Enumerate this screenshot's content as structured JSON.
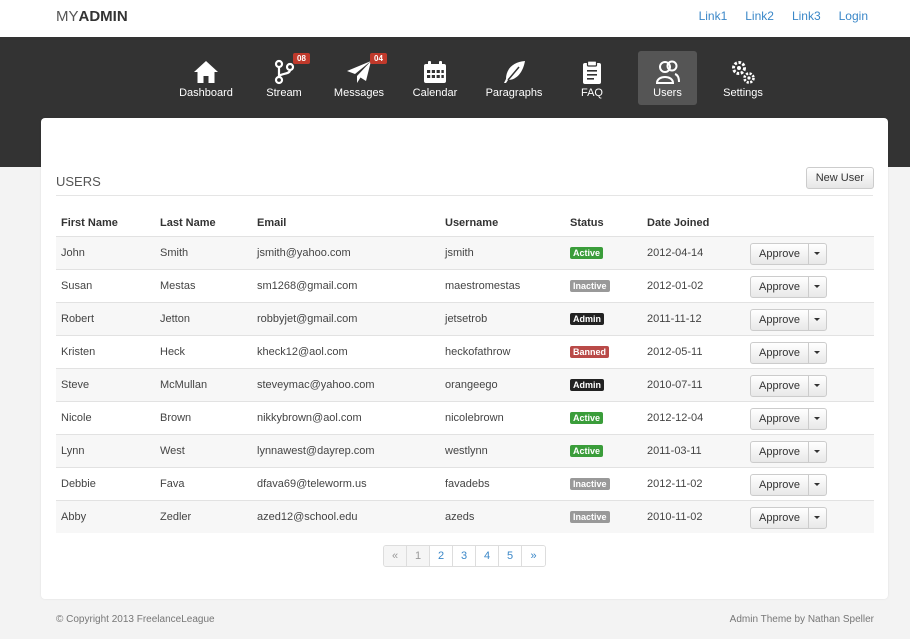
{
  "brand": {
    "prefix": "MY",
    "bold": "ADMIN"
  },
  "top_links": [
    "Link1",
    "Link2",
    "Link3",
    "Login"
  ],
  "nav": [
    {
      "label": "Dashboard",
      "icon": "home-icon",
      "badge": ""
    },
    {
      "label": "Stream",
      "icon": "branch-icon",
      "badge": "08"
    },
    {
      "label": "Messages",
      "icon": "paper-plane-icon",
      "badge": "04"
    },
    {
      "label": "Calendar",
      "icon": "calendar-icon",
      "badge": ""
    },
    {
      "label": "Paragraphs",
      "icon": "feather-icon",
      "badge": ""
    },
    {
      "label": "FAQ",
      "icon": "clipboard-icon",
      "badge": ""
    },
    {
      "label": "Users",
      "icon": "users-icon",
      "badge": "",
      "active": true
    },
    {
      "label": "Settings",
      "icon": "gears-icon",
      "badge": ""
    }
  ],
  "panel": {
    "title": "USERS",
    "new_user_label": "New User"
  },
  "table": {
    "headers": [
      "First Name",
      "Last Name",
      "Email",
      "Username",
      "Status",
      "Date Joined"
    ],
    "rows": [
      [
        "John",
        "Smith",
        "jsmith@yahoo.com",
        "jsmith",
        "Active",
        "2012-04-14"
      ],
      [
        "Susan",
        "Mestas",
        "sm1268@gmail.com",
        "maestromestas",
        "Inactive",
        "2012-01-02"
      ],
      [
        "Robert",
        "Jetton",
        "robbyjet@gmail.com",
        "jetsetrob",
        "Admin",
        "2011-11-12"
      ],
      [
        "Kristen",
        "Heck",
        "kheck12@aol.com",
        "heckofathrow",
        "Banned",
        "2012-05-11"
      ],
      [
        "Steve",
        "McMullan",
        "steveymac@yahoo.com",
        "orangeego",
        "Admin",
        "2010-07-11"
      ],
      [
        "Nicole",
        "Brown",
        "nikkybrown@aol.com",
        "nicolebrown",
        "Active",
        "2012-12-04"
      ],
      [
        "Lynn",
        "West",
        "lynnawest@dayrep.com",
        "westlynn",
        "Active",
        "2011-03-11"
      ],
      [
        "Debbie",
        "Fava",
        "dfava69@teleworm.us",
        "favadebs",
        "Inactive",
        "2012-11-02"
      ],
      [
        "Abby",
        "Zedler",
        "azed12@school.edu",
        "azeds",
        "Inactive",
        "2010-11-02"
      ]
    ],
    "action_label": "Approve"
  },
  "pagination": [
    "«",
    "1",
    "2",
    "3",
    "4",
    "5",
    "»"
  ],
  "colors": {
    "accent": "#3a87c8",
    "nav_bg": "#333333",
    "badge": "#c0392b"
  },
  "footer": {
    "left": "© Copyright 2013 FreelanceLeague",
    "right": "Admin Theme by Nathan Speller"
  }
}
